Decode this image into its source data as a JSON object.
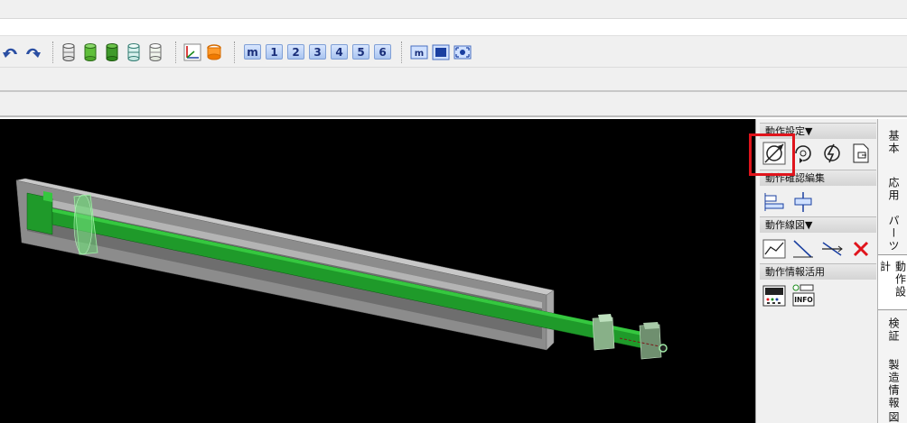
{
  "toolbar": {
    "icons": [
      "undo-icon",
      "redo-icon",
      "cylinder-gray-icon",
      "cylinder-green-icon",
      "cylinder-green-dark-icon",
      "cylinder-teal-icon",
      "cylinder-light-icon",
      "axis-view-icon",
      "orange-cylinder-icon"
    ],
    "view_buttons": [
      "m",
      "1",
      "2",
      "3",
      "4",
      "5",
      "6"
    ],
    "zoom_icons": [
      "zoom-m-icon",
      "frame-icon",
      "fit-icon"
    ]
  },
  "panel": {
    "sections": [
      {
        "label": "動作設定▼",
        "icons": [
          "linear-motion-icon",
          "rotary-motion-icon",
          "motion-arrows-icon",
          "motion-doc-icon"
        ]
      },
      {
        "label": "動作確認編集",
        "icons": [
          "align-edit-icon",
          "align-center-icon"
        ]
      },
      {
        "label": "動作線図▼",
        "icons": [
          "motion-graph-icon",
          "diagonal-line-icon",
          "crossing-lines-icon",
          "delete-x-icon"
        ]
      },
      {
        "label": "動作情報活用",
        "icons": [
          "panel-display-icon",
          "info-icon"
        ]
      }
    ],
    "info_label": "INFO"
  },
  "tabs": [
    {
      "label": "基本"
    },
    {
      "label": "応用"
    },
    {
      "label": "パーツ"
    },
    {
      "label": "動作設計"
    },
    {
      "label": "検証"
    },
    {
      "label": "製造情報"
    },
    {
      "label": "図"
    }
  ],
  "colors": {
    "accent_red": "#e0141c",
    "part_green": "#1f9a2a",
    "viewport_bg": "#000000"
  }
}
